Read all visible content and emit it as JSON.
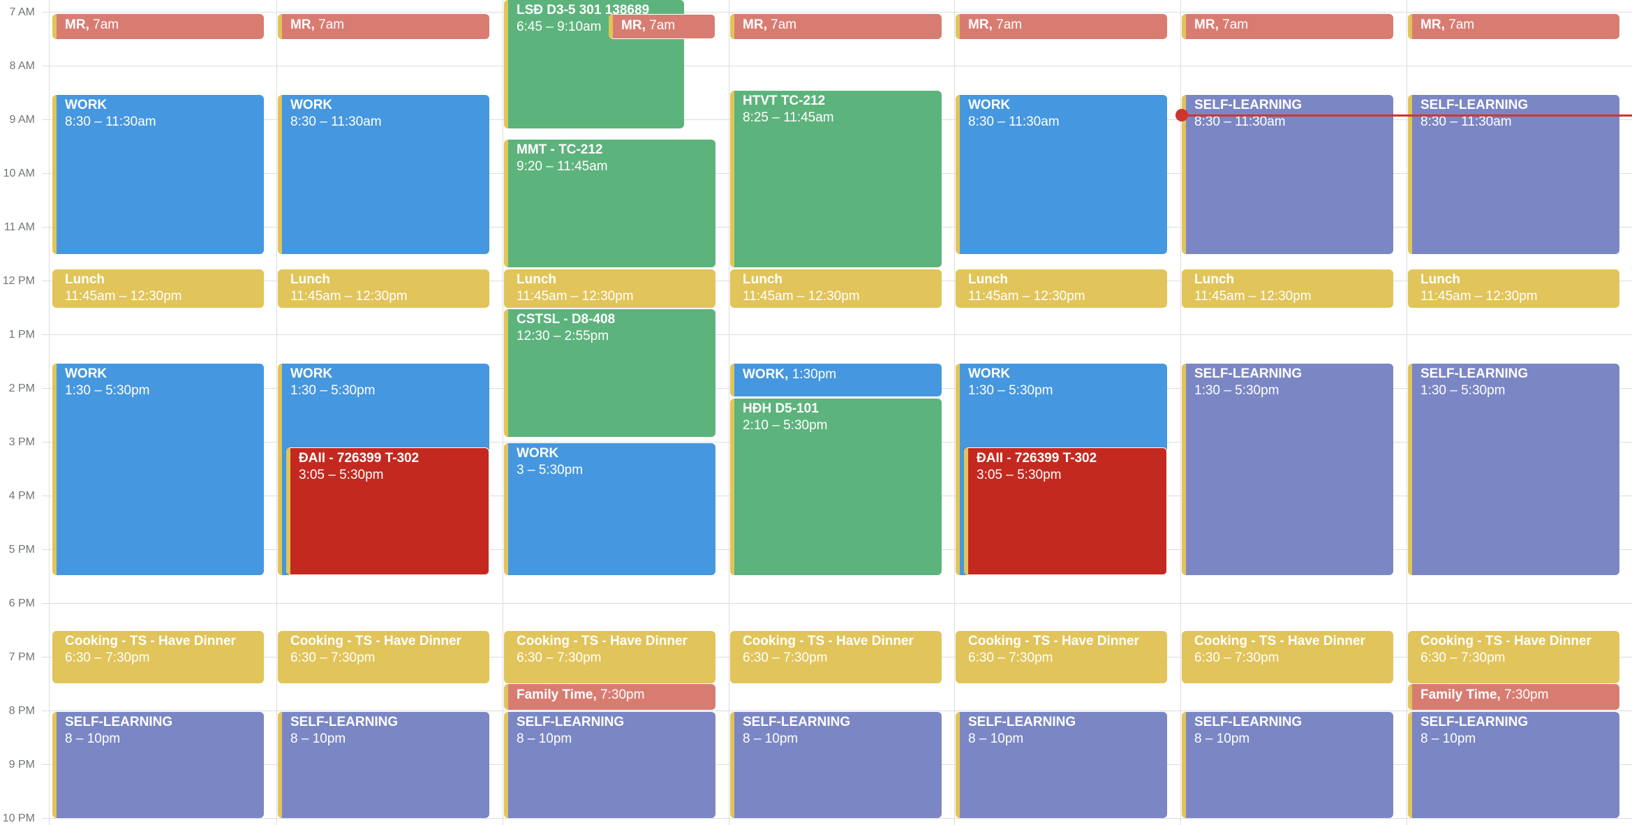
{
  "time_labels": [
    "7 AM",
    "8 AM",
    "9 AM",
    "10 AM",
    "11 AM",
    "12 PM",
    "1 PM",
    "2 PM",
    "3 PM",
    "4 PM",
    "5 PM",
    "6 PM",
    "7 PM",
    "8 PM",
    "9 PM",
    "10 PM"
  ],
  "colors": {
    "red": "#d87c72",
    "blue": "#4597df",
    "green": "#5db37c",
    "yellow": "#e1c45a",
    "purple": "#7b86c5",
    "darkred": "#c4291f",
    "now_indicator": "#d0352c"
  },
  "days": [
    {
      "events": [
        {
          "title": "MR",
          "time": "7am",
          "single": true,
          "color": "red"
        },
        {
          "title": "WORK",
          "time": "8:30 – 11:30am",
          "color": "blue"
        },
        {
          "title": "Lunch",
          "time": "11:45am – 12:30pm",
          "color": "yellow"
        },
        {
          "title": "WORK",
          "time": "1:30 – 5:30pm",
          "color": "blue"
        },
        {
          "title": "Cooking - TS - Have Dinner",
          "time": "6:30 – 7:30pm",
          "color": "yellow"
        },
        {
          "title": "SELF-LEARNING",
          "time": "8 – 10pm",
          "color": "purple"
        }
      ]
    },
    {
      "events": [
        {
          "title": "MR",
          "time": "7am",
          "single": true,
          "color": "red"
        },
        {
          "title": "WORK",
          "time": "8:30 – 11:30am",
          "color": "blue"
        },
        {
          "title": "Lunch",
          "time": "11:45am – 12:30pm",
          "color": "yellow"
        },
        {
          "title": "WORK",
          "time": "1:30 – 5:30pm",
          "color": "blue"
        },
        {
          "title": "ĐAII - 726399 T-302",
          "time": "3:05 – 5:30pm",
          "color": "darkred"
        },
        {
          "title": "Cooking - TS - Have Dinner",
          "time": "6:30 – 7:30pm",
          "color": "yellow"
        },
        {
          "title": "SELF-LEARNING",
          "time": "8 – 10pm",
          "color": "purple"
        }
      ]
    },
    {
      "events": [
        {
          "title": "LSĐ D3-5 301 138689",
          "time": "6:45 – 9:10am",
          "color": "green"
        },
        {
          "title": "MR",
          "time": "7am",
          "single": true,
          "color": "red"
        },
        {
          "title": "MMT - TC-212",
          "time": "9:20 – 11:45am",
          "color": "green"
        },
        {
          "title": "Lunch",
          "time": "11:45am – 12:30pm",
          "color": "yellow"
        },
        {
          "title": "CSTSL - D8-408",
          "time": "12:30 – 2:55pm",
          "color": "green"
        },
        {
          "title": "WORK",
          "time": "3 – 5:30pm",
          "color": "blue"
        },
        {
          "title": "Cooking - TS - Have Dinner",
          "time": "6:30 – 7:30pm",
          "color": "yellow"
        },
        {
          "title": "Family Time",
          "time": "7:30pm",
          "single": true,
          "color": "red"
        },
        {
          "title": "SELF-LEARNING",
          "time": "8 – 10pm",
          "color": "purple"
        }
      ]
    },
    {
      "events": [
        {
          "title": "MR",
          "time": "7am",
          "single": true,
          "color": "red"
        },
        {
          "title": "HTVT TC-212",
          "time": "8:25 – 11:45am",
          "color": "green"
        },
        {
          "title": "Lunch",
          "time": "11:45am – 12:30pm",
          "color": "yellow"
        },
        {
          "title": "WORK",
          "time": "1:30pm",
          "single": true,
          "color": "blue"
        },
        {
          "title": "HĐH D5-101",
          "time": "2:10 – 5:30pm",
          "color": "green"
        },
        {
          "title": "Cooking - TS - Have Dinner",
          "time": "6:30 – 7:30pm",
          "color": "yellow"
        },
        {
          "title": "SELF-LEARNING",
          "time": "8 – 10pm",
          "color": "purple"
        }
      ]
    },
    {
      "events": [
        {
          "title": "MR",
          "time": "7am",
          "single": true,
          "color": "red"
        },
        {
          "title": "WORK",
          "time": "8:30 – 11:30am",
          "color": "blue"
        },
        {
          "title": "Lunch",
          "time": "11:45am – 12:30pm",
          "color": "yellow"
        },
        {
          "title": "WORK",
          "time": "1:30 – 5:30pm",
          "color": "blue"
        },
        {
          "title": "ĐAII - 726399 T-302",
          "time": "3:05 – 5:30pm",
          "color": "darkred"
        },
        {
          "title": "Cooking - TS - Have Dinner",
          "time": "6:30 – 7:30pm",
          "color": "yellow"
        },
        {
          "title": "SELF-LEARNING",
          "time": "8 – 10pm",
          "color": "purple"
        }
      ]
    },
    {
      "events": [
        {
          "title": "MR",
          "time": "7am",
          "single": true,
          "color": "red"
        },
        {
          "title": "SELF-LEARNING",
          "time": "8:30 – 11:30am",
          "color": "purple"
        },
        {
          "title": "Lunch",
          "time": "11:45am – 12:30pm",
          "color": "yellow"
        },
        {
          "title": "SELF-LEARNING",
          "time": "1:30 – 5:30pm",
          "color": "purple"
        },
        {
          "title": "Cooking - TS - Have Dinner",
          "time": "6:30 – 7:30pm",
          "color": "yellow"
        },
        {
          "title": "SELF-LEARNING",
          "time": "8 – 10pm",
          "color": "purple"
        }
      ]
    },
    {
      "events": [
        {
          "title": "MR",
          "time": "7am",
          "single": true,
          "color": "red"
        },
        {
          "title": "SELF-LEARNING",
          "time": "8:30 – 11:30am",
          "color": "purple"
        },
        {
          "title": "Lunch",
          "time": "11:45am – 12:30pm",
          "color": "yellow"
        },
        {
          "title": "SELF-LEARNING",
          "time": "1:30 – 5:30pm",
          "color": "purple"
        },
        {
          "title": "Cooking - TS - Have Dinner",
          "time": "6:30 – 7:30pm",
          "color": "yellow"
        },
        {
          "title": "Family Time",
          "time": "7:30pm",
          "single": true,
          "color": "red"
        },
        {
          "title": "SELF-LEARNING",
          "time": "8 – 10pm",
          "color": "purple"
        }
      ]
    }
  ]
}
